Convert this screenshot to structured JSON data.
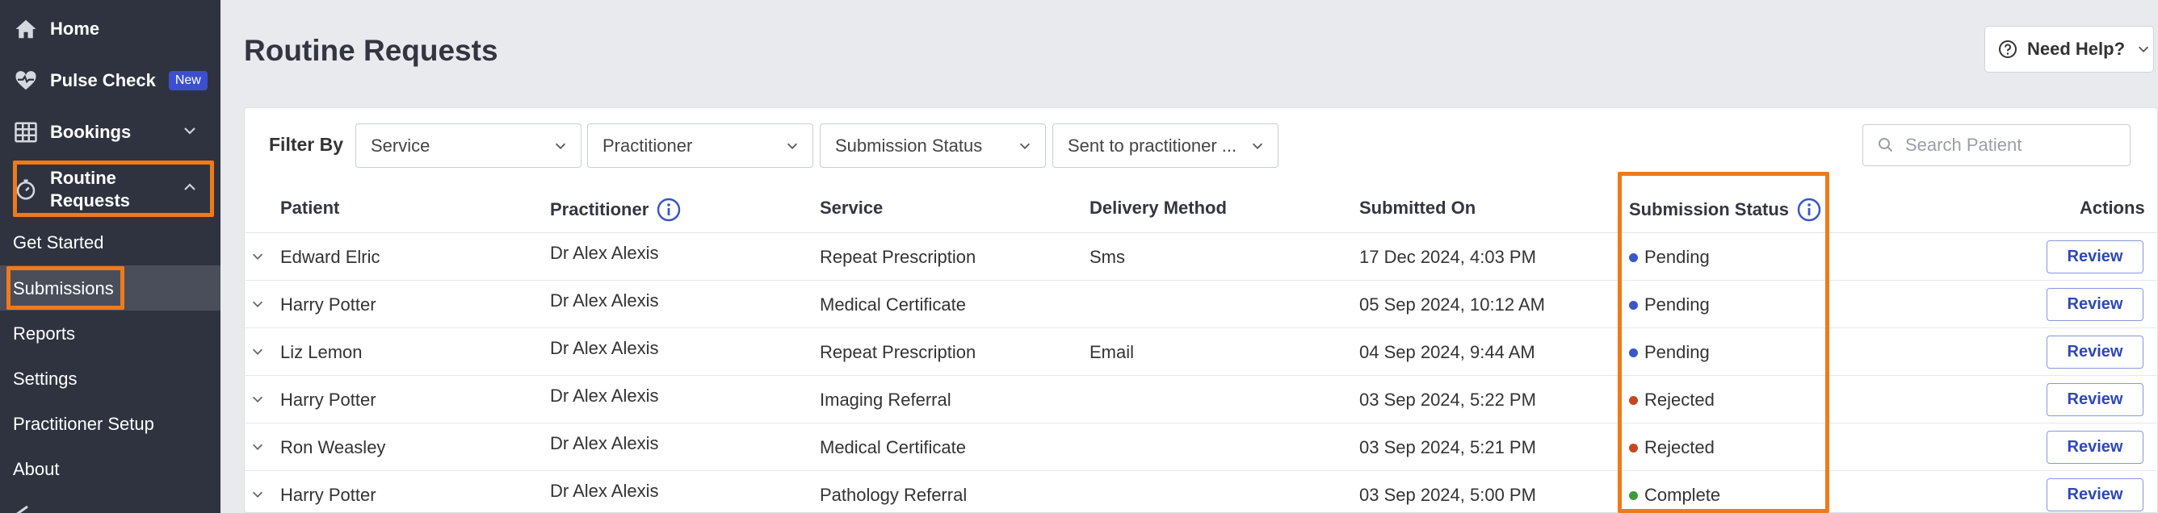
{
  "sidebar": {
    "home": "Home",
    "pulse_check": "Pulse Check",
    "pulse_badge": "New",
    "bookings": "Bookings",
    "routine_requests_line1": "Routine",
    "routine_requests_line2": "Requests",
    "sub_items": [
      "Get Started",
      "Submissions",
      "Reports",
      "Settings",
      "Practitioner Setup",
      "About"
    ],
    "active_item": "Submissions"
  },
  "header": {
    "title": "Routine Requests",
    "help_label": "Need Help?"
  },
  "filters": {
    "label": "Filter By",
    "service": "Service",
    "practitioner": "Practitioner",
    "submission_status": "Submission Status",
    "sent_to_practitioner": "Sent to practitioner ...",
    "search_placeholder": "Search Patient"
  },
  "table": {
    "columns": [
      "Patient",
      "Practitioner",
      "Service",
      "Delivery Method",
      "Submitted On",
      "Submission Status",
      "Actions"
    ],
    "action_label": "Review",
    "rows": [
      {
        "patient": "Edward Elric",
        "practitioner": "Dr Alex Alexis",
        "service": "Repeat Prescription",
        "delivery": "Sms",
        "submitted": "17 Dec 2024, 4:03 PM",
        "status": "Pending"
      },
      {
        "patient": "Harry Potter",
        "practitioner": "Dr Alex Alexis",
        "service": "Medical Certificate",
        "delivery": "",
        "submitted": "05 Sep 2024, 10:12 AM",
        "status": "Pending"
      },
      {
        "patient": "Liz Lemon",
        "practitioner": "Dr Alex Alexis",
        "service": "Repeat Prescription",
        "delivery": "Email",
        "submitted": "04 Sep 2024, 9:44 AM",
        "status": "Pending"
      },
      {
        "patient": "Harry Potter",
        "practitioner": "Dr Alex Alexis",
        "service": "Imaging Referral",
        "delivery": "",
        "submitted": "03 Sep 2024, 5:22 PM",
        "status": "Rejected"
      },
      {
        "patient": "Ron Weasley",
        "practitioner": "Dr Alex Alexis",
        "service": "Medical Certificate",
        "delivery": "",
        "submitted": "03 Sep 2024, 5:21 PM",
        "status": "Rejected"
      },
      {
        "patient": "Harry Potter",
        "practitioner": "Dr Alex Alexis",
        "service": "Pathology Referral",
        "delivery": "",
        "submitted": "03 Sep 2024, 5:00 PM",
        "status": "Complete"
      }
    ]
  },
  "status_colors": {
    "Pending": "#3a57c8",
    "Rejected": "#c8461e",
    "Complete": "#3d9a3f"
  },
  "accent_color": "#f07a1a"
}
